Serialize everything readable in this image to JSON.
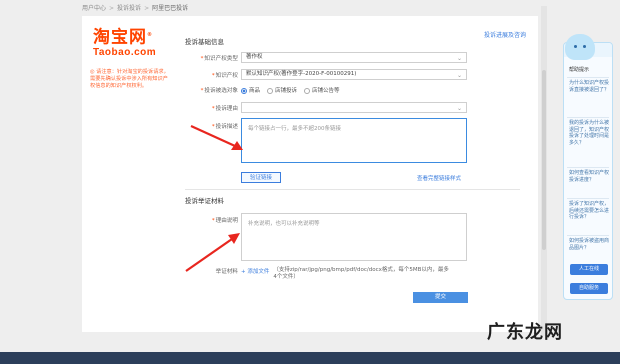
{
  "breadcrumb": {
    "item1": "用户中心",
    "item2": "投诉投诉",
    "current": "阿里巴巴投诉"
  },
  "logo": {
    "cn": "淘宝网",
    "reg": "®",
    "en": "Taobao.com"
  },
  "notice": "◎ 请注意：针对淘宝的投诉请求，需要先确认投诉中涉入所有知识产权信息的知识产权权利。",
  "top_link": "投诉进展及咨询",
  "section1_title": "投诉基础信息",
  "section2_title": "投诉举证材料",
  "fields": {
    "ip_type": {
      "label": "知识产权类型",
      "value": "著作权"
    },
    "ip_right": {
      "label": "知识产权",
      "value": "默认知识产权(著作登字-2020-F-00100291)"
    },
    "object": {
      "label": "投诉被选对象",
      "options": [
        "商品",
        "店铺投诉",
        "店铺公告等"
      ]
    },
    "reason": {
      "label": "投诉理由",
      "value": ""
    },
    "desc": {
      "label": "投诉描述",
      "placeholder": "每个链接占一行，最多不超200条链接"
    },
    "evidence": {
      "label": "理由说明",
      "placeholder": "补充说明，也可以补充说明等"
    },
    "attach": {
      "label": "举证材料",
      "add_label": "+ 添加文件",
      "hint": "（支持zip/rar/jpg/png/bmp/pdf/doc/docx格式，每个5MB以内，最多4个文件）"
    }
  },
  "buttons": {
    "verify": "验证链接",
    "example": "查看完整链接样式",
    "submit": "提交"
  },
  "right_panel": {
    "title": "帮助提示",
    "questions": [
      "为什么知识产权投诉直接被退回了？",
      "我的投诉为什么被退回了，知识产权投诉了处理时间是多久？",
      "如何查看知识产权投诉进度？",
      "投诉了知识产权，后续还需要怎么进行投诉？",
      "如何投诉被盗用商品图片？"
    ],
    "btn_online": "人工在线",
    "btn_self": "自助服务"
  },
  "watermark": {
    "left": "广东龙网",
    "brand": "广东龙网"
  },
  "colors": {
    "accent": "#3b7ddd",
    "brand": "#ff4400",
    "arrow": "#e8261f"
  }
}
